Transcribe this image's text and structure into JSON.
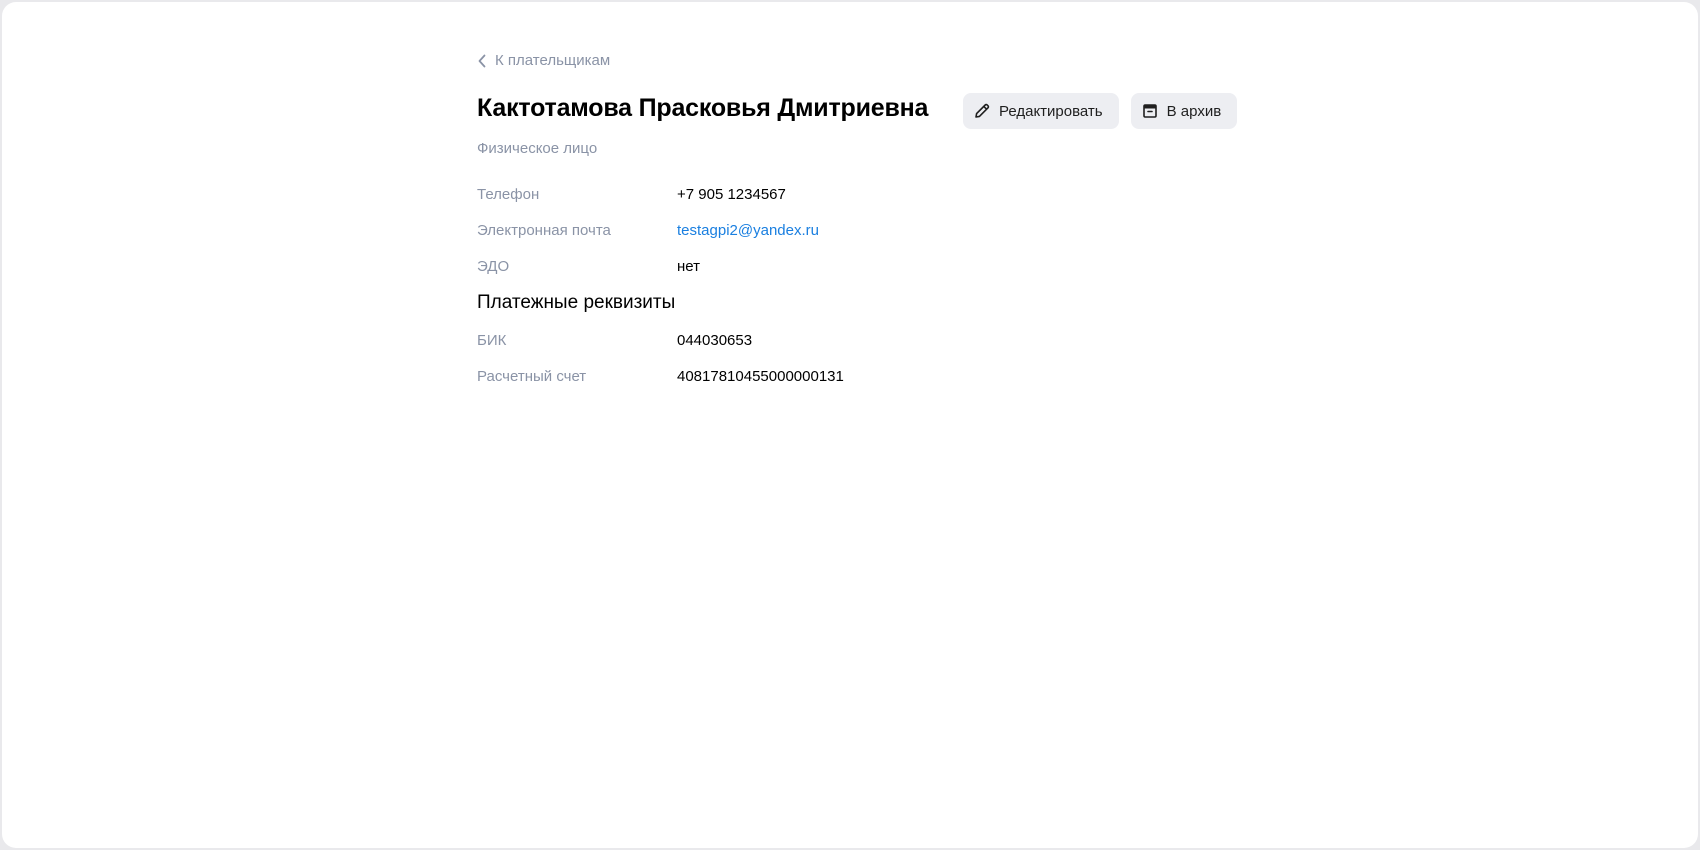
{
  "back_link": {
    "label": "К плательщикам",
    "icon": "chevron-left-icon"
  },
  "payer": {
    "name": "Кактотамова Прасковья Дмитриевна",
    "type": "Физическое лицо"
  },
  "actions": {
    "edit_label": "Редактировать",
    "edit_icon": "pencil-icon",
    "archive_label": "В архив",
    "archive_icon": "archive-icon"
  },
  "contacts": [
    {
      "label": "Телефон",
      "value": "+7 905 1234567"
    },
    {
      "label": "Электронная почта",
      "value": "testagpi2@yandex.ru"
    },
    {
      "label": "ЭДО",
      "value": "нет"
    }
  ],
  "payment_details": {
    "title": "Платежные реквизиты",
    "rows": [
      {
        "label": "БИК",
        "value": "044030653"
      },
      {
        "label": "Расчетный счет",
        "value": "40817810455000000131"
      }
    ]
  },
  "colors": {
    "muted_text": "#8a93a6",
    "link": "#1a7fe0",
    "button_bg": "#edeef2"
  }
}
